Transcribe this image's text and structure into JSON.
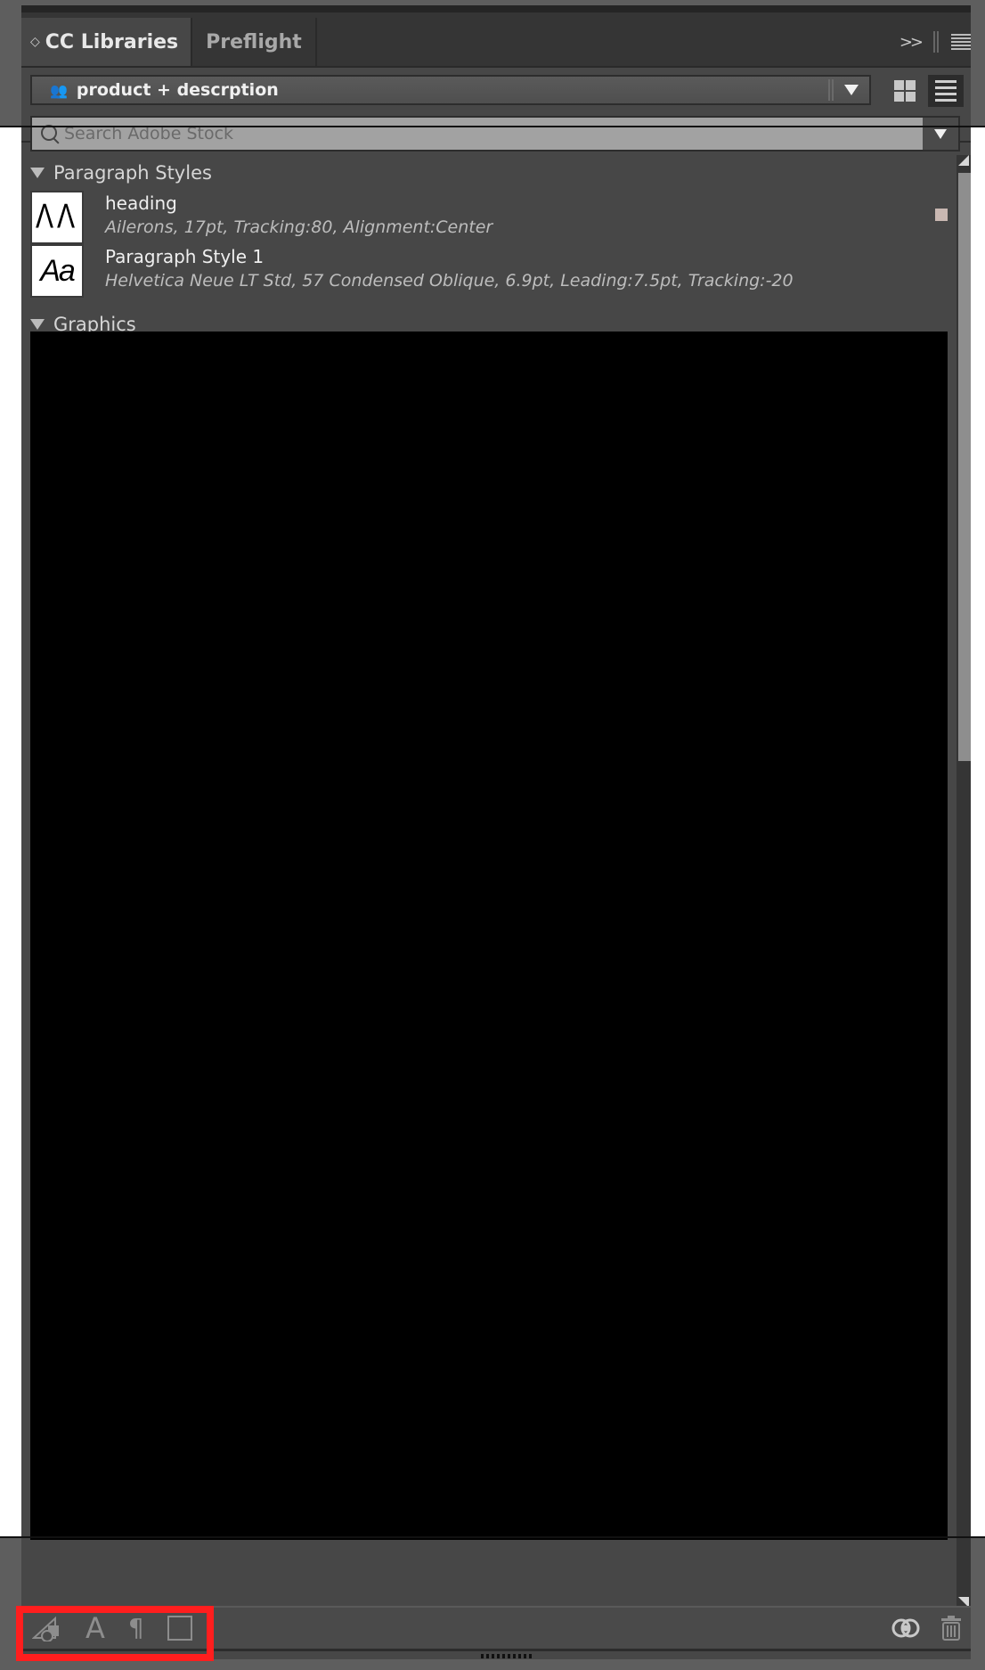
{
  "tabs": [
    {
      "label": "CC Libraries",
      "active": true
    },
    {
      "label": "Preflight",
      "active": false
    }
  ],
  "tabbar_icons": {
    "collapse": "double-chevron-right-icon",
    "menu": "panel-menu-icon"
  },
  "library": {
    "shared_icon": "people-icon",
    "selected": "product + descrption",
    "views": [
      "grid-view",
      "list-view"
    ],
    "active_view": "list-view"
  },
  "search": {
    "placeholder": "Search Adobe Stock",
    "value": ""
  },
  "sections": {
    "paragraph_styles": {
      "title": "Paragraph Styles",
      "items": [
        {
          "name": "heading",
          "description": "Ailerons, 17pt, Tracking:80, Alignment:Center",
          "thumb": "ΛΛ",
          "swatch_color": "#c9b8b2"
        },
        {
          "name": "Paragraph Style 1",
          "description": "Helvetica Neue LT Std, 57 Condensed Oblique, 6.9pt, Leading:7.5pt, Tracking:-20",
          "thumb": "Aa"
        }
      ]
    },
    "graphics": {
      "title": "Graphics"
    }
  },
  "footer": {
    "left_icons": [
      "add-graphic-icon",
      "add-character-style-icon",
      "add-paragraph-style-icon",
      "add-color-icon"
    ],
    "text_glyph": "A",
    "para_glyph": "¶",
    "right_icons": [
      "creative-cloud-icon",
      "trash-icon"
    ]
  },
  "highlight_color": "#ff1e1e"
}
